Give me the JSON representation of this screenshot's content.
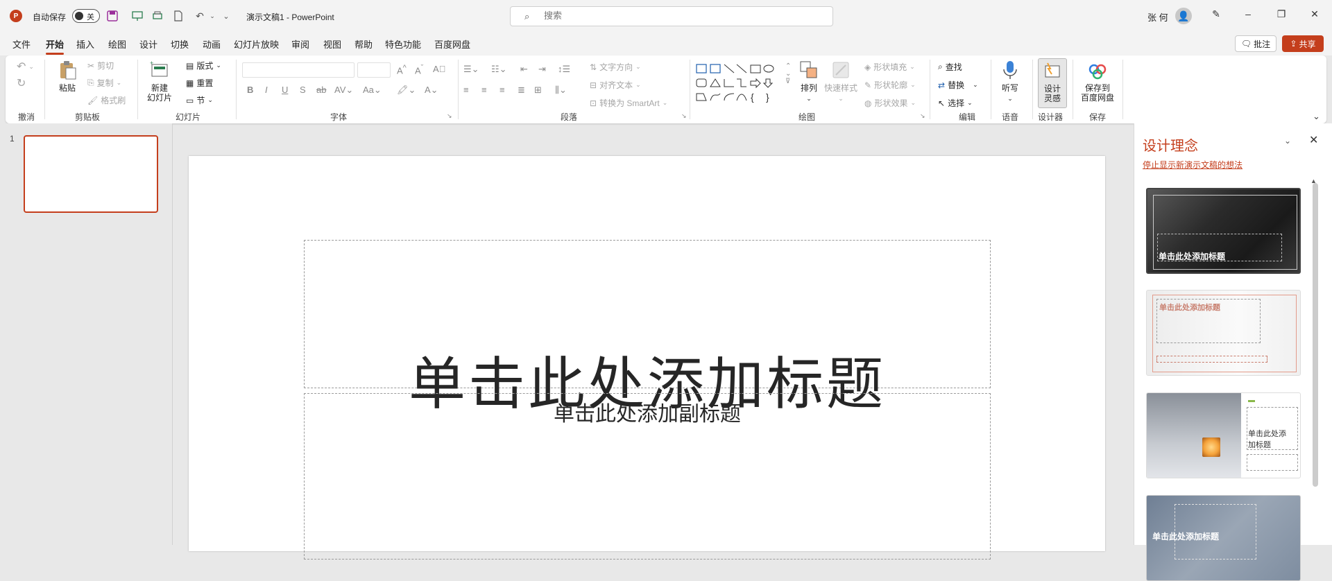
{
  "titlebar": {
    "autosave_label": "自动保存",
    "autosave_state": "关",
    "doc_title": "演示文稿1  -  PowerPoint",
    "search_placeholder": "搜索",
    "user_name": "张 何"
  },
  "menu": {
    "tabs": [
      "文件",
      "开始",
      "插入",
      "绘图",
      "设计",
      "切换",
      "动画",
      "幻灯片放映",
      "审阅",
      "视图",
      "帮助",
      "特色功能",
      "百度网盘"
    ],
    "active": "开始",
    "comment": "批注",
    "share": "共享"
  },
  "ribbon": {
    "groups": {
      "undo": "撤消",
      "clipboard": "剪贴板",
      "slides": "幻灯片",
      "font": "字体",
      "paragraph": "段落",
      "drawing": "绘图",
      "editing": "编辑",
      "voice": "语音",
      "designer": "设计器",
      "save": "保存"
    },
    "clipboard": {
      "paste": "粘贴",
      "cut": "剪切",
      "copy": "复制",
      "format_painter": "格式刷"
    },
    "slides": {
      "new_slide_1": "新建",
      "new_slide_2": "幻灯片",
      "layout": "版式",
      "reset": "重置",
      "section": "节"
    },
    "paragraph": {
      "text_direction": "文字方向",
      "align_text": "对齐文本",
      "convert_smartart": "转换为 SmartArt"
    },
    "drawing": {
      "arrange": "排列",
      "quick_styles": "快速样式",
      "shape_fill": "形状填充",
      "shape_outline": "形状轮廓",
      "shape_effects": "形状效果"
    },
    "editing": {
      "find": "查找",
      "replace": "替换",
      "select": "选择"
    },
    "voice": {
      "dictate": "听写"
    },
    "designer": {
      "design_ideas_1": "设计",
      "design_ideas_2": "灵感"
    },
    "save": {
      "save_baidu_1": "保存到",
      "save_baidu_2": "百度网盘"
    }
  },
  "thumbnails": {
    "slide_number": "1"
  },
  "slide": {
    "title_placeholder": "单击此处添加标题",
    "subtitle_placeholder": "单击此处添加副标题"
  },
  "design_pane": {
    "title": "设计理念",
    "stop_link": "停止显示新演示文稿的想法",
    "cards": [
      {
        "title": "单击此处添加标题"
      },
      {
        "title": "单击此处添加标题"
      },
      {
        "title": "单击此处添加标题"
      },
      {
        "title": "单击此处添加标题"
      }
    ]
  },
  "colors": {
    "accent": "#c43e1c",
    "ribbon_bg": "#ffffff",
    "window_bg": "#f3f3f3"
  },
  "icons": [
    "powerpoint-logo",
    "save-icon",
    "undo-icon",
    "redo-icon",
    "search-icon",
    "pen-icon",
    "minimize-icon",
    "restore-icon",
    "close-icon",
    "comment-icon",
    "share-icon",
    "microphone-icon",
    "designer-icon",
    "baidu-cloud-icon"
  ]
}
